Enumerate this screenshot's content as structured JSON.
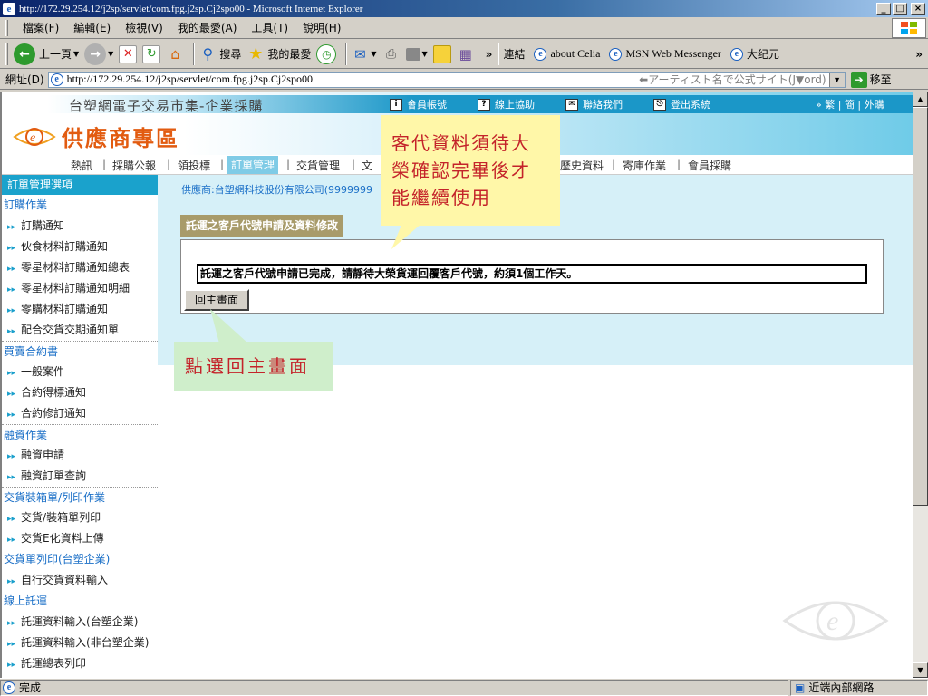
{
  "window": {
    "title": "http://172.29.254.12/j2sp/servlet/com.fpg.j2sp.Cj2spo00 - Microsoft Internet Explorer",
    "minimize": "_",
    "maximize": "□",
    "close": "×"
  },
  "menu": [
    "檔案(F)",
    "編輯(E)",
    "檢視(V)",
    "我的最愛(A)",
    "工具(T)",
    "說明(H)"
  ],
  "toolbar": {
    "back": "上一頁",
    "search": "搜尋",
    "favorites": "我的最愛",
    "chevron": "»",
    "links_label": "連結",
    "links": [
      "about Celia",
      "MSN Web Messenger",
      "大纪元"
    ]
  },
  "address": {
    "label": "網址(D)",
    "url": "http://172.29.254.12/j2sp/servlet/com.fpg.j2sp.Cj2spo00",
    "search_hint": "⬅アーティスト名で公式サイト(J▼ord)",
    "go": "移至"
  },
  "site": {
    "name": "台塑網電子交易市集-企業採購",
    "toplinks": [
      "會員帳號",
      "線上協助",
      "聯絡我們",
      "登出系統"
    ],
    "lang": "» 繁 | 簡 | 外購",
    "logo_text": "供應商專區"
  },
  "nav": {
    "items": [
      "熱訊",
      "採購公報",
      "領投標",
      "訂單管理",
      "交貨管理",
      "文",
      "歷史資料",
      "寄庫作業",
      "會員採購"
    ],
    "sep": "|"
  },
  "sidebar": {
    "header": "訂單管理選項",
    "groups": [
      {
        "title": "訂購作業",
        "items": [
          "訂購通知",
          "伙食材料訂購通知",
          "零星材料訂購通知總表",
          "零星材料訂購通知明細",
          "零購材料訂購通知",
          "配合交貨交期通知單"
        ]
      },
      {
        "title": "買賣合約書",
        "items": [
          "一般案件",
          "合約得標通知",
          "合約修訂通知"
        ]
      },
      {
        "title": "融資作業",
        "items": [
          "融資申請",
          "融資訂單查詢"
        ]
      },
      {
        "title": "交貨裝箱單/列印作業",
        "items": [
          "交貨/裝箱單列印",
          "交貨E化資料上傳"
        ]
      },
      {
        "title": "交貨單列印(台塑企業)",
        "items": [
          "自行交貨資料輸入"
        ]
      },
      {
        "title": "線上託運",
        "items": [
          "託運資料輸入(台塑企業)",
          "託運資料輸入(非台塑企業)",
          "託運總表列印"
        ]
      }
    ]
  },
  "main": {
    "supplier": "供應商:台塑網科技股份有限公司(9999999",
    "panel_title": "託運之客戶代號申請及資料修改",
    "message": "託運之客戶代號申請已完成，請靜待大榮貨運回覆客戶代號，約須1個工作天。",
    "home_button": "回主畫面"
  },
  "annotations": {
    "yellow": [
      "客代資料須待大",
      "榮確認完畢後才",
      "能繼續使用"
    ],
    "green": "點選回主畫面"
  },
  "status": {
    "text": "完成",
    "zone": "近端內部網路"
  }
}
